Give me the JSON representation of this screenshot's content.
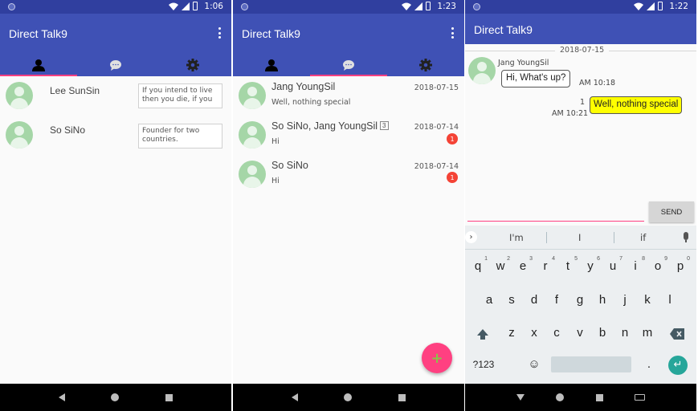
{
  "screens": [
    {
      "status_time": "1:06",
      "app_title": "Direct Talk9",
      "tabs": [
        "person-icon",
        "chat-icon",
        "settings-icon"
      ],
      "active_tab": 0,
      "friends": [
        {
          "name": "Lee SunSin",
          "status": "If you intend to live then you die, if you ..."
        },
        {
          "name": "So SiNo",
          "status": "Founder for two countries."
        }
      ]
    },
    {
      "status_time": "1:23",
      "app_title": "Direct Talk9",
      "active_tab": 1,
      "rooms": [
        {
          "name": "Jang YoungSil",
          "count": "",
          "last_msg": "Well, nothing special",
          "date": "2018-07-15",
          "unread": ""
        },
        {
          "name": "So SiNo, Jang YoungSil",
          "count": "3",
          "last_msg": "Hi",
          "date": "2018-07-14",
          "unread": "1"
        },
        {
          "name": "So SiNo",
          "count": "",
          "last_msg": "Hi",
          "date": "2018-07-14",
          "unread": "1"
        }
      ],
      "fab_label": "+"
    },
    {
      "status_time": "1:22",
      "app_title": "Direct Talk9",
      "date_separator": "2018-07-15",
      "incoming": {
        "sender": "Jang YoungSil",
        "text": "Hi, What's up?",
        "time": "AM 10:18"
      },
      "outgoing": {
        "text": "Well, nothing special",
        "unread": "1",
        "time": "AM 10:21"
      },
      "input_value": "",
      "send_label": "SEND",
      "suggestions": [
        "I'm",
        "I",
        "if"
      ],
      "keyboard": {
        "row1": [
          "q",
          "w",
          "e",
          "r",
          "t",
          "y",
          "u",
          "i",
          "o",
          "p"
        ],
        "row1_hints": [
          "1",
          "2",
          "3",
          "4",
          "5",
          "6",
          "7",
          "8",
          "9",
          "0"
        ],
        "row2": [
          "a",
          "s",
          "d",
          "f",
          "g",
          "h",
          "j",
          "k",
          "l"
        ],
        "row3": [
          "z",
          "x",
          "c",
          "v",
          "b",
          "n",
          "m"
        ],
        "sym_label": "?123",
        "emoji": "☺",
        "period": "."
      }
    }
  ],
  "colors": {
    "primary": "#3f51b5",
    "primary_dark": "#303f9f",
    "accent": "#ff4081",
    "avatar": "#a5d6a7",
    "badge": "#f44336",
    "outgoing_bubble": "#ffff00"
  }
}
